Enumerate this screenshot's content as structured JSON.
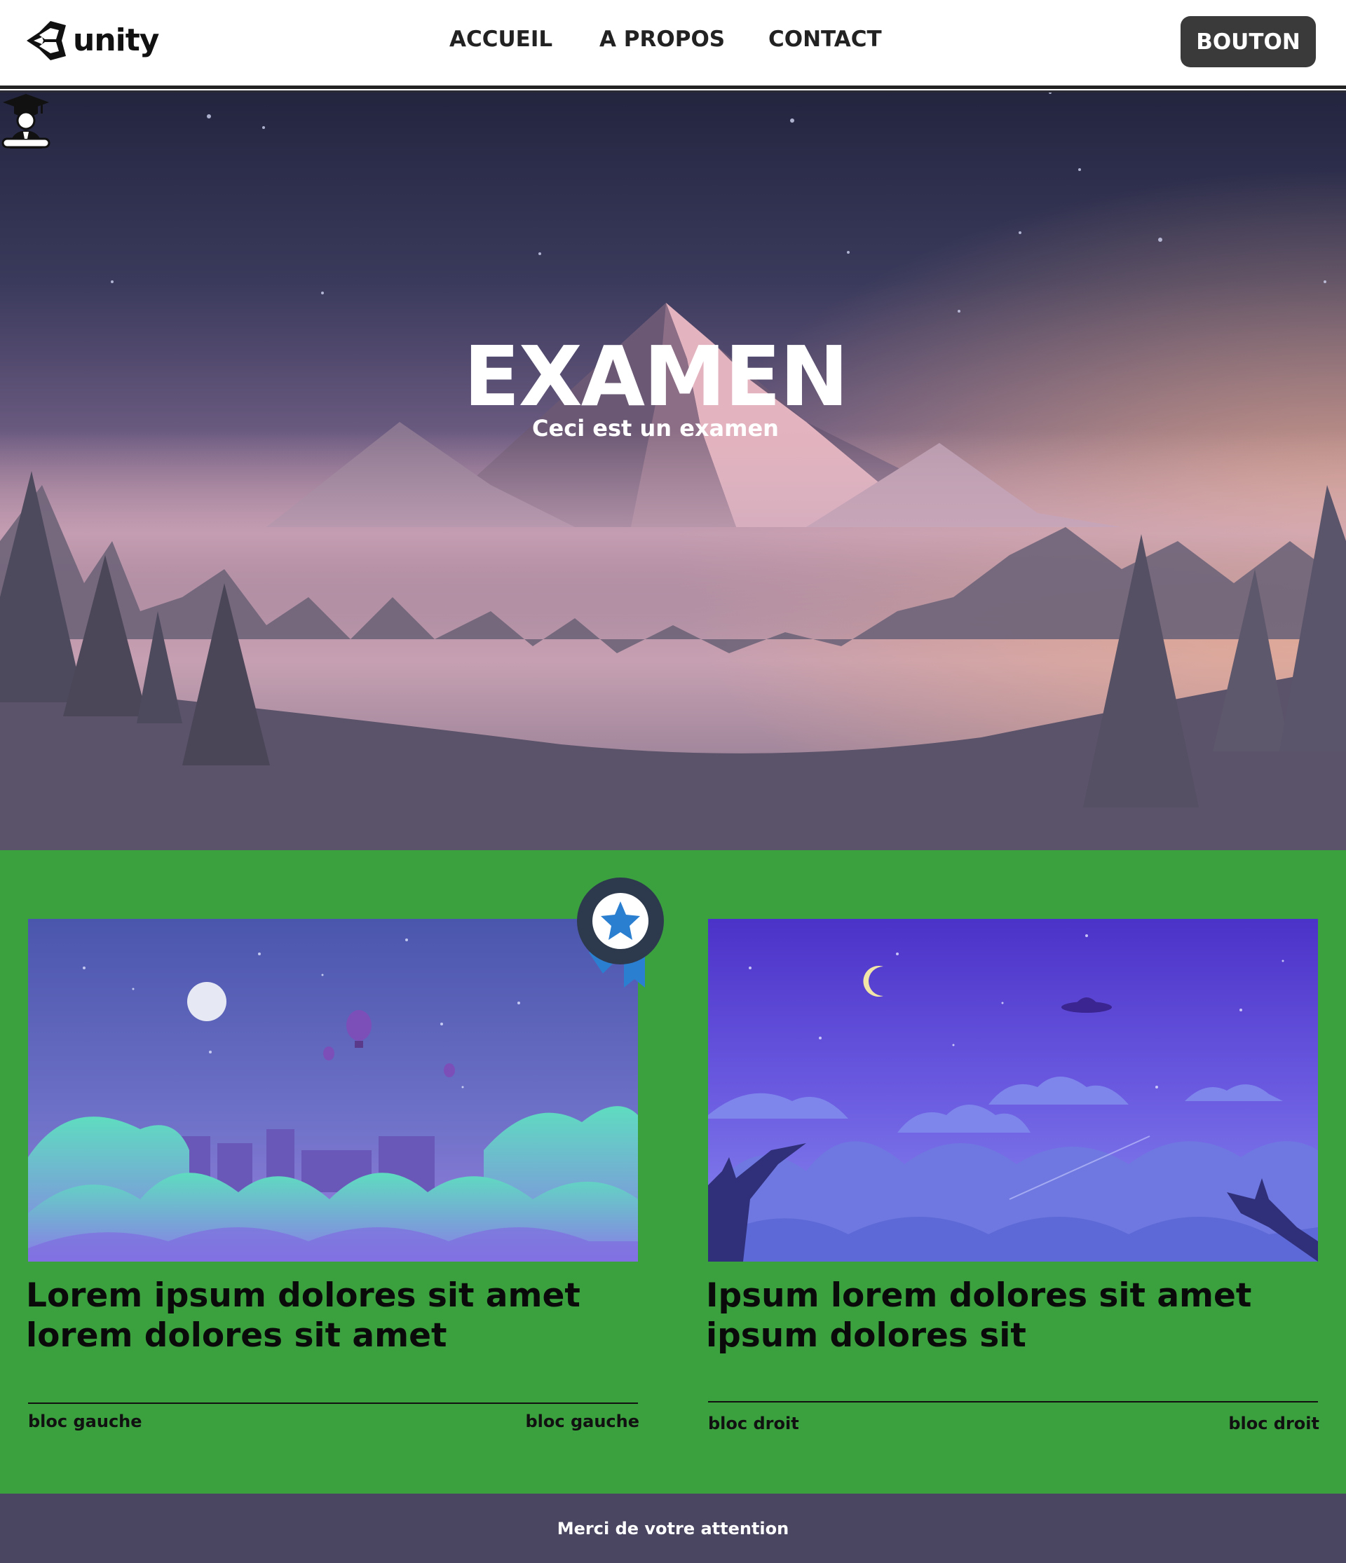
{
  "nav": {
    "logo_text": "unity",
    "menu": [
      "ACCUEIL",
      "A PROPOS",
      "CONTACT"
    ],
    "button_label": "BOUTON"
  },
  "hero": {
    "title": "EXAMEN",
    "subtitle": "Ceci est un examen"
  },
  "cards": [
    {
      "title": "Lorem ipsum dolores sit amet lorem dolores sit amet",
      "footer_left": "bloc gauche",
      "footer_right": "bloc gauche"
    },
    {
      "title": "Ipsum lorem dolores sit amet ipsum dolores sit",
      "footer_left": "bloc droit",
      "footer_right": "bloc droit"
    }
  ],
  "footer": {
    "text": "Merci de votre attention"
  },
  "colors": {
    "content_bg": "#3ba13f",
    "footer_bg": "#4a4560",
    "button_bg": "#3a3a3a"
  }
}
